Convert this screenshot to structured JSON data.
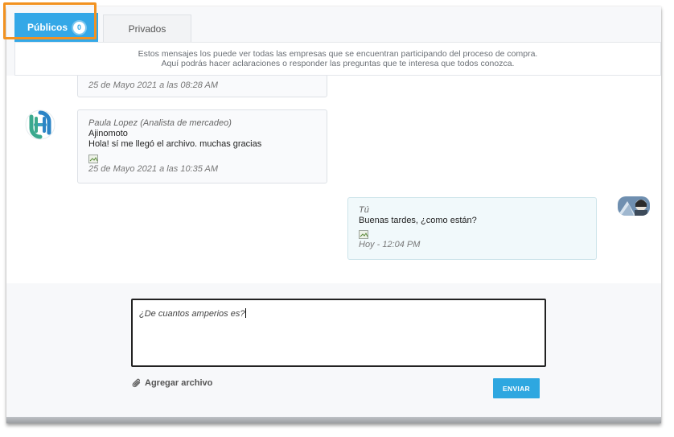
{
  "tabs": {
    "public_label": "Públicos",
    "public_count": "0",
    "private_label": "Privados"
  },
  "info": {
    "line1": "Estos mensajes los puede ver todas las empresas que se encuentran participando del proceso de compra.",
    "line2": "Aquí podrás hacer aclaraciones o responder las preguntas que te interesa que todos conozca."
  },
  "messages": [
    {
      "time": "25 de Mayo 2021 a las 08:28 AM"
    },
    {
      "author": "Paula Lopez (Analista de mercadeo)",
      "company": "Ajinomoto",
      "text": "Hola! sí me llegó el archivo. muchas gracias",
      "time": "25 de Mayo 2021 a las 10:35 AM"
    },
    {
      "author": "Tú",
      "text": "Buenas tardes, ¿como están?",
      "time": "Hoy - 12:04 PM"
    }
  ],
  "composer": {
    "value": "¿De cuantos amperios es?",
    "attach_label": "Agregar archivo",
    "send_label": "ENVIAR"
  },
  "colors": {
    "accent": "#34a8e7",
    "highlight": "#f29221"
  },
  "icons": {
    "attach": "paperclip-icon",
    "broken_image": "broken-image-icon"
  }
}
